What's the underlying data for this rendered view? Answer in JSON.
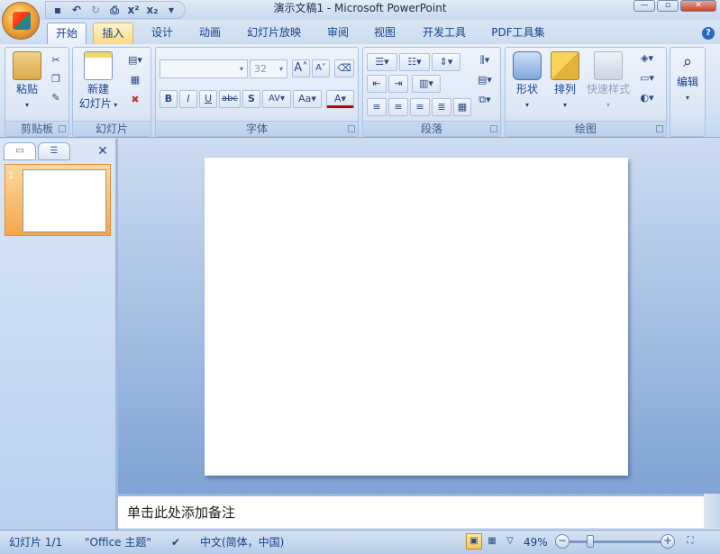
{
  "window": {
    "title": "演示文稿1 - Microsoft PowerPoint"
  },
  "qat": {
    "save_icon": "save-icon",
    "undo_icon": "undo-icon",
    "redo_icon": "redo-icon",
    "preview_icon": "print-preview-icon",
    "superscript": "x²",
    "subscript": "x₂",
    "customize": "▾"
  },
  "tabs": [
    "开始",
    "插入",
    "设计",
    "动画",
    "幻灯片放映",
    "审阅",
    "视图",
    "开发工具",
    "PDF工具集"
  ],
  "ribbon": {
    "clipboard": {
      "label": "剪贴板",
      "paste": "粘贴"
    },
    "slides": {
      "label": "幻灯片",
      "new_slide_line1": "新建",
      "new_slide_line2": "幻灯片"
    },
    "font": {
      "label": "字体",
      "font_name": "",
      "font_size": "32",
      "bold": "B",
      "italic": "I",
      "underline": "U",
      "strike": "abc",
      "shadow": "S",
      "spacing": "AV",
      "case": "Aa",
      "color": "A",
      "grow": "A",
      "shrink": "A"
    },
    "paragraph": {
      "label": "段落"
    },
    "drawing": {
      "label": "绘图",
      "shapes": "形状",
      "arrange": "排列",
      "quick_styles": "快速样式"
    },
    "editing": {
      "label": "编辑"
    }
  },
  "notes": {
    "placeholder": "单击此处添加备注"
  },
  "status": {
    "slide": "幻灯片 1/1",
    "theme": "\"Office 主题\"",
    "language": "中文(简体，中国)",
    "zoom": "49%"
  },
  "thumbnail": {
    "number": "1"
  },
  "colors": {
    "accent": "#f6a64a",
    "ribbon": "#dce7f6",
    "text": "#15428b"
  }
}
